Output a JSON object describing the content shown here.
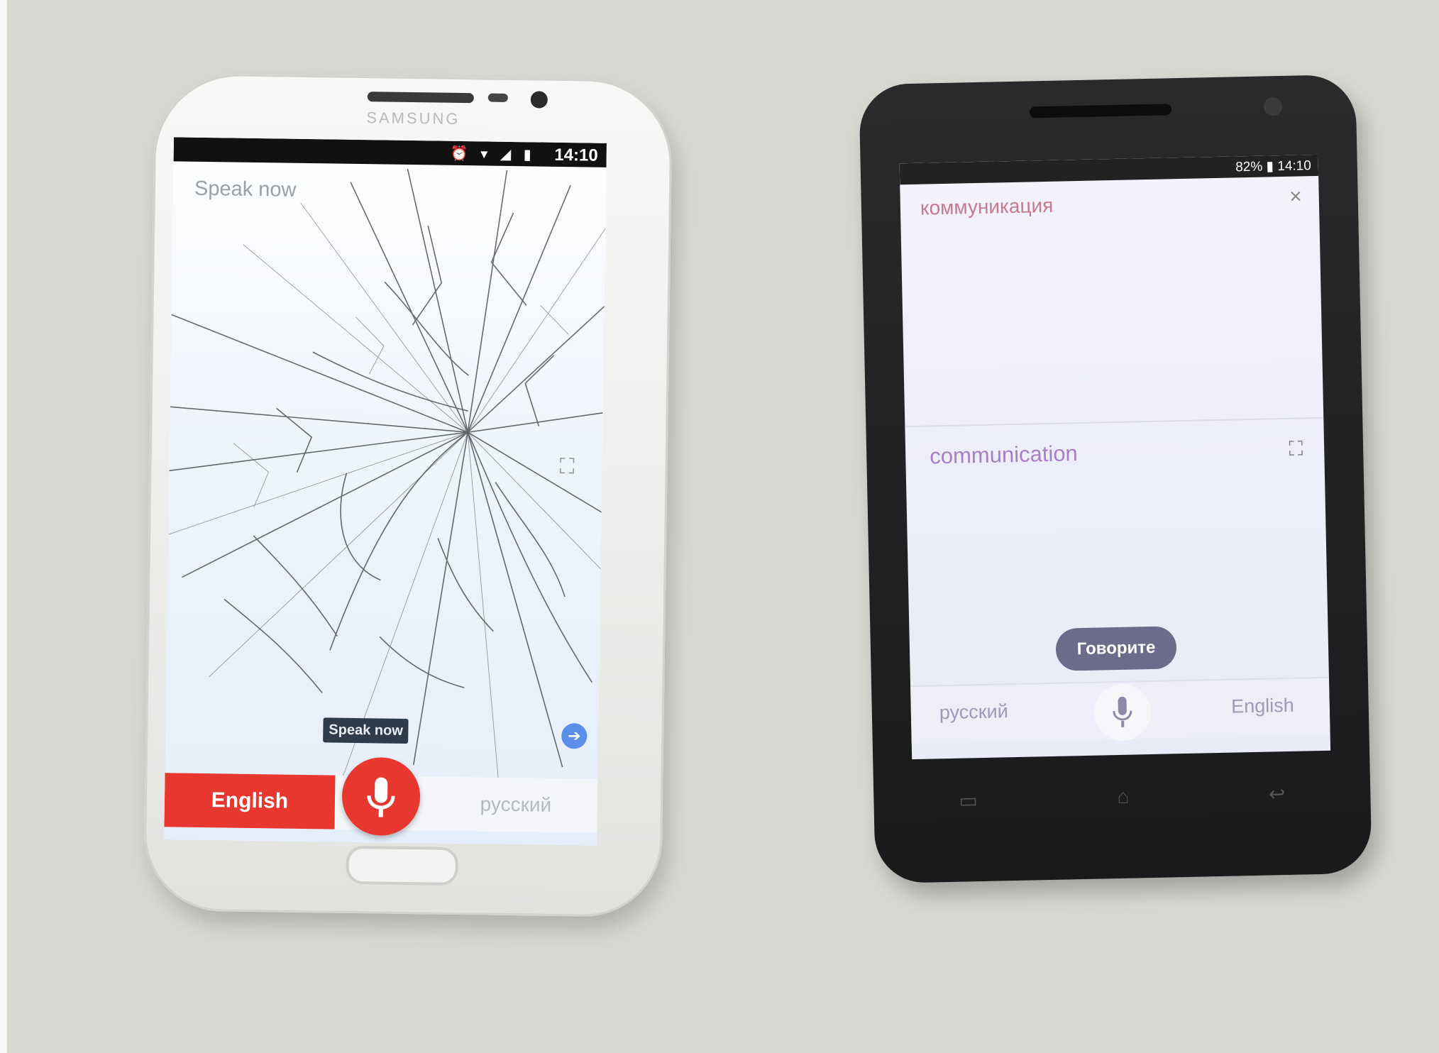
{
  "scene": {
    "left_phone": {
      "brand": "SAMSUNG",
      "status_time": "14:10",
      "status_icons": "⏰ ▾ ◢ ▮",
      "prompt_text": "Speak now",
      "tooltip_text": "Speak now",
      "source_language": "English",
      "target_language": "русский",
      "icons": {
        "mic": "microphone-icon",
        "fullscreen": "fullscreen-icon",
        "arrow": "arrow-right-icon"
      },
      "accent_color": "#e8372f"
    },
    "right_phone": {
      "status_text": "82% ▮ 14:10",
      "source_text": "коммуникация",
      "translated_text": "communication",
      "speak_button": "Говорите",
      "source_language": "русский",
      "target_language": "English",
      "close_symbol": "×",
      "icons": {
        "close": "close-icon",
        "fullscreen": "fullscreen-icon",
        "mic": "microphone-icon"
      },
      "accent_color": "#6c6b8a"
    }
  }
}
